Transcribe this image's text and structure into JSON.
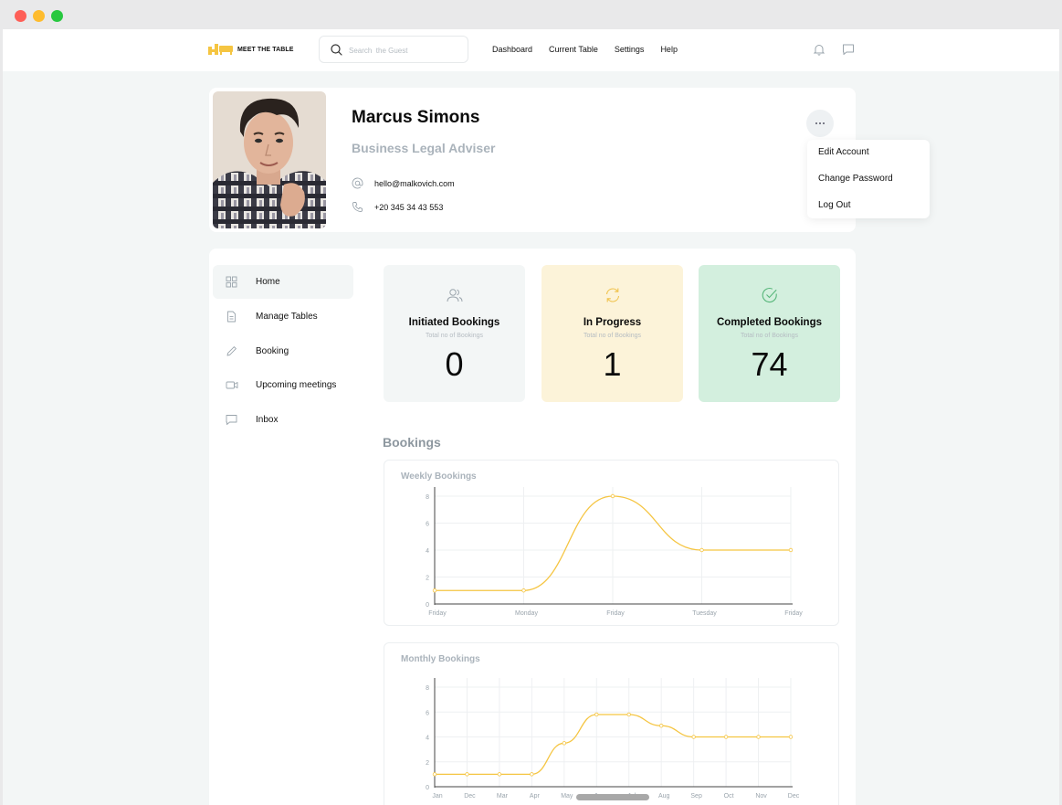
{
  "window": {
    "controls": [
      {
        "name": "close",
        "color": "#fe5f57"
      },
      {
        "name": "minimize",
        "color": "#febc2e"
      },
      {
        "name": "maximize",
        "color": "#28c840"
      }
    ]
  },
  "nav": {
    "logo_text": "MEET THE TABLE",
    "logo_color": "#f5c542",
    "search_placeholder": "Search  the Guest",
    "links": [
      "Dashboard",
      "Current Table",
      "Settings",
      "Help"
    ],
    "icons": [
      "bell-icon",
      "message-icon"
    ]
  },
  "profile": {
    "name": "Marcus Simons",
    "role": "Business Legal Adviser",
    "email": "hello@malkovich.com",
    "phone": "+20 345 34 43 553",
    "menu": [
      "Edit Account",
      "Change Password",
      "Log Out"
    ]
  },
  "sidebar": {
    "items": [
      {
        "label": "Home",
        "icon": "grid-icon",
        "active": true
      },
      {
        "label": "Manage Tables",
        "icon": "document-icon",
        "active": false
      },
      {
        "label": "Booking",
        "icon": "pencil-icon",
        "active": false
      },
      {
        "label": "Upcoming meetings",
        "icon": "video-icon",
        "active": false
      },
      {
        "label": "Inbox",
        "icon": "chat-icon",
        "active": false
      }
    ]
  },
  "stats": [
    {
      "title": "Initiated Bookings",
      "subtitle": "Total no of Bookings",
      "value": "0",
      "bg": "#f3f6f6",
      "icon": "users-icon",
      "icon_color": "#9aa4ac"
    },
    {
      "title": "In Progress",
      "subtitle": "Total no of Bookings",
      "value": "1",
      "bg": "#fcf3d9",
      "icon": "refresh-icon",
      "icon_color": "#f0c24b"
    },
    {
      "title": "Completed Bookings",
      "subtitle": "Total no of Bookings",
      "value": "74",
      "bg": "#d3efde",
      "icon": "check-circle-icon",
      "icon_color": "#57b67a"
    }
  ],
  "bookings_title": "Bookings",
  "chart_data": [
    {
      "type": "line",
      "title": "Weekly Bookings",
      "categories": [
        "Friday",
        "Monday",
        "Friday",
        "Tuesday",
        "Friday"
      ],
      "series": [
        {
          "values": [
            1,
            1,
            8,
            4,
            4
          ]
        }
      ],
      "ylim": [
        0,
        8
      ],
      "yticks": [
        0,
        2,
        4,
        6,
        8
      ],
      "color": "#f5c542",
      "grid": true
    },
    {
      "type": "line",
      "title": "Monthly Bookings",
      "categories": [
        "Jan",
        "Dec",
        "Mar",
        "Apr",
        "May",
        "Jun",
        "Jul",
        "Aug",
        "Sep",
        "Oct",
        "Nov",
        "Dec"
      ],
      "series": [
        {
          "values": [
            1,
            1,
            1,
            1,
            3.5,
            5.8,
            5.8,
            4.9,
            4,
            4,
            4,
            4
          ]
        }
      ],
      "ylim": [
        0,
        8
      ],
      "yticks": [
        0,
        2,
        4,
        6,
        8
      ],
      "color": "#f5c542",
      "grid": true
    }
  ]
}
